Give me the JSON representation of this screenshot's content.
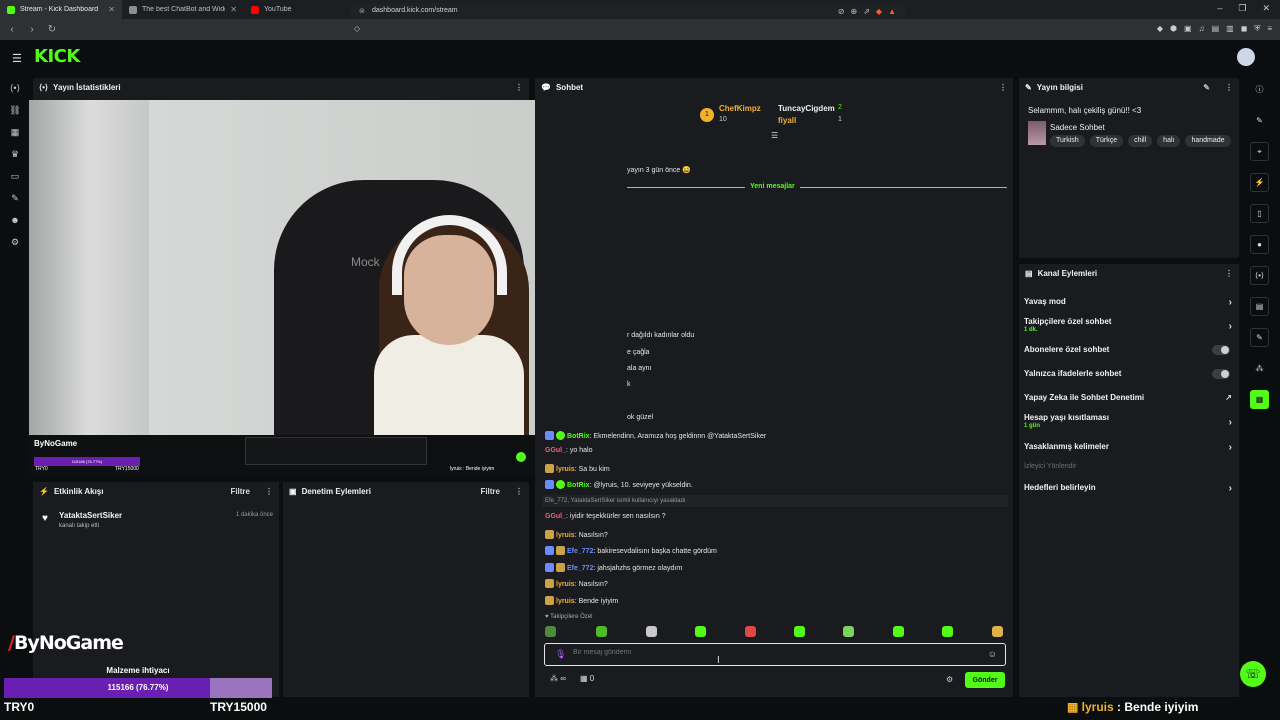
{
  "browser": {
    "tabs": [
      {
        "title": "Stream - Kick Dashboard",
        "active": true,
        "favicon_color": "#53fc18"
      },
      {
        "title": "The best ChatBot and Widgets fo",
        "active": false,
        "favicon_color": "#8e8e8e"
      },
      {
        "title": "YouTube",
        "active": false,
        "favicon_color": "#ff0000"
      }
    ],
    "url": "dashboard.kick.com/stream"
  },
  "app": {
    "logo": "KICK"
  },
  "panels": {
    "stats_title": "Yayın İstatistikleri",
    "chat_title": "Sohbet",
    "info_title": "Yayın bilgisi",
    "activity_title": "Etkinlik Akışı",
    "moderation_title": "Denetim Eylemleri",
    "filter_label": "Filtre",
    "channel_actions_title": "Kanal Eylemleri"
  },
  "video": {
    "chair_brand": "Mock"
  },
  "overlay_mini": {
    "logo": "ByNoGame",
    "bar": "115166 (76.77%)",
    "min": "TRY0",
    "max": "TRY15000",
    "msg": "lyruis : Bende iyiyim"
  },
  "activity": {
    "user": "YataktaSertSiker",
    "desc": "kanalı takip etti",
    "time": "1 dakika önce"
  },
  "goal": {
    "logo_slash": "/",
    "logo_text": "ByNoGame",
    "title": "Malzeme ihtiyacı",
    "text": "115166 (76.77%)",
    "progress": 0.7677,
    "min": "TRY0",
    "max": "TRY15000",
    "fill_color": "#6a1fb3",
    "track_color": "#9b74c0"
  },
  "chat": {
    "top": {
      "user1": "ChefKimpz",
      "user1_count": "10",
      "user2": "TuncayCigdem",
      "user2_count": "2",
      "user3": "fiyall",
      "user3_count": "1"
    },
    "fragments": [
      "yayın 3 gün önce 😄",
      "r dağıldı kadınlar oldu",
      "e çağla",
      "ala aynı",
      "k",
      "ok güzel"
    ],
    "new_messages_label": "Yeni mesajlar",
    "lines": [
      {
        "user": "BotRix",
        "color": "#53fc18",
        "text": ": Ekmelendinn, Aramıza hoş geldinnn @YataktaSertSiker"
      },
      {
        "user": "GGul_",
        "color": "#ff5a7a",
        "text": ": yo halo"
      },
      {
        "user": "lyruis",
        "color": "#f1b12d",
        "text": ": Sa bu kim"
      },
      {
        "user": "BotRix",
        "color": "#53fc18",
        "text": ": @lyruis, 10. seviyeye yükseldin."
      },
      {
        "user": "GGul_",
        "color": "#ff5a7a",
        "text": ": iyidir teşekkürler sen nasılsın ?"
      },
      {
        "user": "lyruis",
        "color": "#f1b12d",
        "text": ": Nasılsın?"
      },
      {
        "user": "Efe_772",
        "color": "#6a8cff",
        "text": ": bakiresevdalisını başka chatte gördüm"
      },
      {
        "user": "Efe_772",
        "color": "#6a8cff",
        "text": ": jahsjahzhs görmez olaydım"
      },
      {
        "user": "lyruis",
        "color": "#f1b12d",
        "text": ": Nasılsın?"
      },
      {
        "user": "lyruis",
        "color": "#f1b12d",
        "text": ": Bende iyiyim"
      }
    ],
    "system_line": "Efe_772, YataktaSertSiker isimli kullanıcıyı yasakladı",
    "followers_only": "Takipçilere Özel",
    "input_placeholder": "Bir mesaj gönderin",
    "viewers": "∞",
    "points": "0",
    "send_label": "Gönder"
  },
  "info": {
    "title": "Selammm, halı çekiliş günü!! <3",
    "category": "Sadece Sohbet",
    "tags": [
      "Turkish",
      "Türkçe",
      "chill",
      "halı",
      "handmade"
    ]
  },
  "channel_actions": {
    "slow_mode": "Yavaş mod",
    "followers_chat": "Takipçilere özel sohbet",
    "followers_chat_sub": "1 dk.",
    "subs_chat": "Abonelere özel sohbet",
    "emote_chat": "Yalnızca ifadelerle sohbet",
    "ai_mod": "Yapay Zeka ile Sohbet Denetimi",
    "age_limit": "Hesap yaşı kısıtlaması",
    "age_limit_sub": "1 gün",
    "banned_words": "Yasaklanmış kelimeler",
    "redirect": "İzleyici Yönlendir",
    "goals": "Hedefleri belirleyin"
  },
  "bottom_msg": {
    "user": "lyruis",
    "text": " : Bende iyiyim"
  }
}
